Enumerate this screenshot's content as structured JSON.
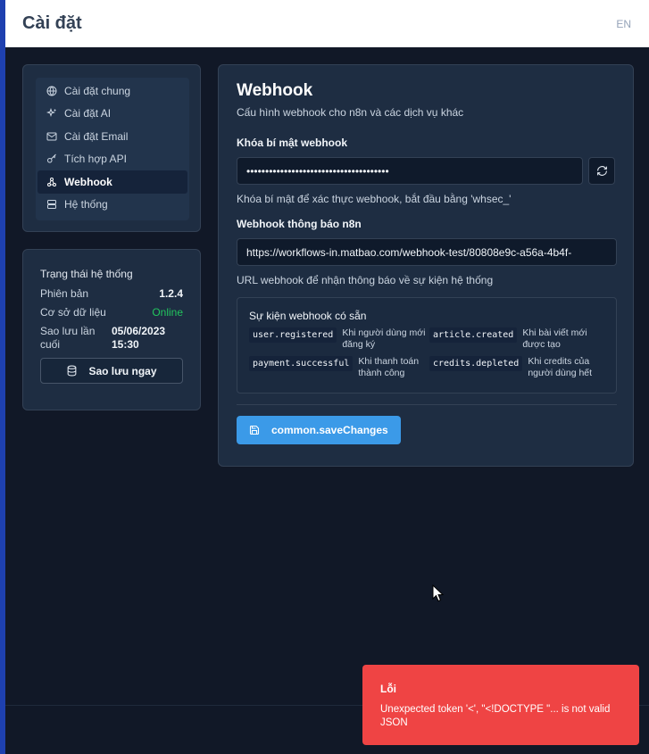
{
  "header": {
    "title": "Cài đặt",
    "lang": "EN"
  },
  "nav": {
    "items": [
      {
        "label": "Cài đặt chung",
        "icon": "globe-icon"
      },
      {
        "label": "Cài đặt AI",
        "icon": "sparkles-icon"
      },
      {
        "label": "Cài đặt Email",
        "icon": "mail-icon"
      },
      {
        "label": "Tích hợp API",
        "icon": "key-icon"
      },
      {
        "label": "Webhook",
        "icon": "webhook-icon",
        "active": true
      },
      {
        "label": "Hệ thống",
        "icon": "server-icon"
      }
    ]
  },
  "status": {
    "title": "Trạng thái hệ thống",
    "version_label": "Phiên bản",
    "version_value": "1.2.4",
    "db_label": "Cơ sở dữ liệu",
    "db_value": "Online",
    "backup_label": "Sao lưu lần cuối",
    "backup_value": "05/06/2023 15:30",
    "backup_button": "Sao lưu ngay"
  },
  "webhook": {
    "title": "Webhook",
    "subtitle": "Cấu hình webhook cho n8n và các dịch vụ khác",
    "secret_label": "Khóa bí mật webhook",
    "secret_value": "••••••••••••••••••••••••••••••••••••••",
    "secret_help": "Khóa bí mật để xác thực webhook, bắt đầu bằng 'whsec_'",
    "url_label": "Webhook thông báo n8n",
    "url_value": "https://workflows-in.matbao.com/webhook-test/80808e9c-a56a-4b4f-",
    "url_help": "URL webhook để nhận thông báo về sự kiện hệ thống",
    "events_title": "Sự kiện webhook có sẵn",
    "events": [
      {
        "code": "user.registered",
        "desc": "Khi người dùng mới đăng ký"
      },
      {
        "code": "article.created",
        "desc": "Khi bài viết mới được tạo"
      },
      {
        "code": "payment.successful",
        "desc": "Khi thanh toán thành công"
      },
      {
        "code": "credits.depleted",
        "desc": "Khi credits của người dùng hết"
      }
    ],
    "save_button": "common.saveChanges"
  },
  "toast": {
    "title": "Lỗi",
    "message": "Unexpected token '<', \"<!DOCTYPE \"... is not valid JSON"
  },
  "colors": {
    "accent": "#3b9ae8",
    "error": "#ef4444",
    "online": "#22c55e"
  }
}
